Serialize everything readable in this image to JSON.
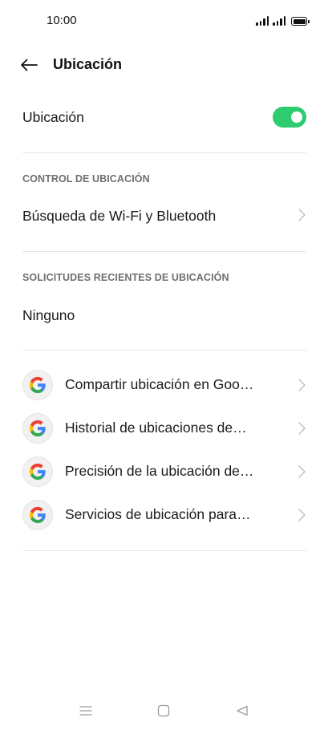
{
  "status_bar": {
    "time": "10:00"
  },
  "header": {
    "title": "Ubicación"
  },
  "location_toggle": {
    "label": "Ubicación",
    "enabled": true,
    "accent_color": "#2ecc71"
  },
  "location_control": {
    "header": "CONTROL DE UBICACIÓN",
    "wifi_bluetooth_label": "Búsqueda de Wi-Fi y Bluetooth"
  },
  "recent_requests": {
    "header": "SOLICITUDES RECIENTES DE UBICACIÓN",
    "none_label": "Ninguno"
  },
  "google_services": [
    {
      "label": "Compartir ubicación en Goo…",
      "icon": "google-g-icon"
    },
    {
      "label": "Historial de ubicaciones de…",
      "icon": "google-g-icon"
    },
    {
      "label": "Precisión de la ubicación de…",
      "icon": "google-g-icon"
    },
    {
      "label": "Servicios de ubicación para…",
      "icon": "google-g-icon"
    }
  ],
  "nav_bar": {
    "icons": [
      "menu-icon",
      "home-icon",
      "back-triangle-icon"
    ]
  }
}
